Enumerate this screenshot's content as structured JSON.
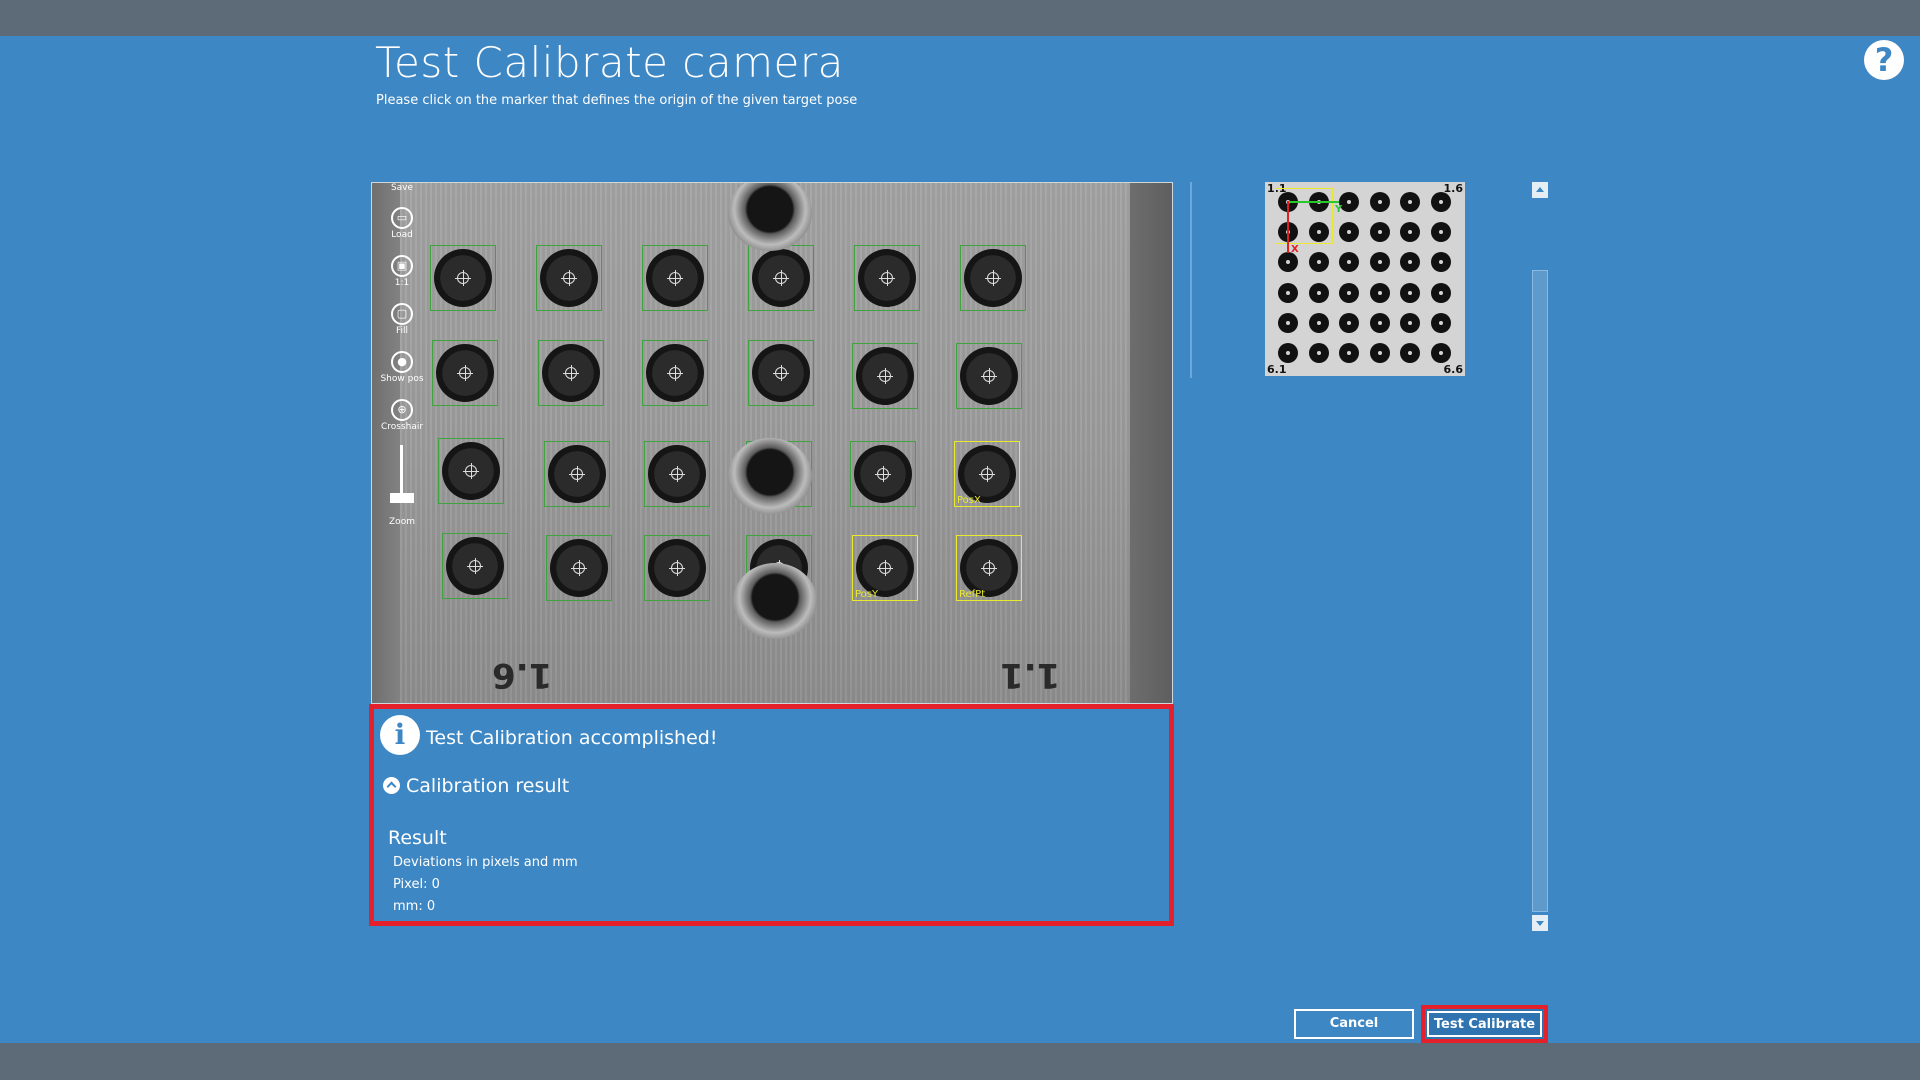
{
  "header": {
    "title": "Test Calibrate camera",
    "subtitle": "Please click on the marker that defines the origin of the given target pose",
    "help_icon": "?"
  },
  "toolbar": {
    "save": "Save",
    "load": "Load",
    "one_to_one": "1:1",
    "fill": "Fill",
    "show_pos": "Show pos",
    "crosshair": "Crosshair",
    "zoom": "Zoom"
  },
  "camera": {
    "labels": {
      "pos_x": "PosX",
      "pos_y": "PosY",
      "ref_pt": "RefPt"
    },
    "plate_marks": {
      "left": "1.6",
      "right": "1.1"
    }
  },
  "target_preview": {
    "corners": {
      "top_left": "1.1",
      "top_right": "1.6",
      "bottom_left": "6.1",
      "bottom_right": "6.6"
    },
    "axes": {
      "x": "X",
      "y": "Y"
    },
    "rows": 6,
    "cols": 6
  },
  "result_panel": {
    "status_text": "Test Calibration accomplished!",
    "section_title": "Calibration result",
    "heading": "Result",
    "lines": [
      "Deviations in pixels and mm",
      "Pixel: 0",
      "mm: 0"
    ]
  },
  "buttons": {
    "cancel": "Cancel",
    "test_calibrate": "Test Calibrate"
  },
  "colors": {
    "background": "#3d87c4",
    "bar": "#5d6b78",
    "highlight": "#e4202a",
    "marker_green": "#3fa43f",
    "marker_yellow": "#e9e930"
  }
}
